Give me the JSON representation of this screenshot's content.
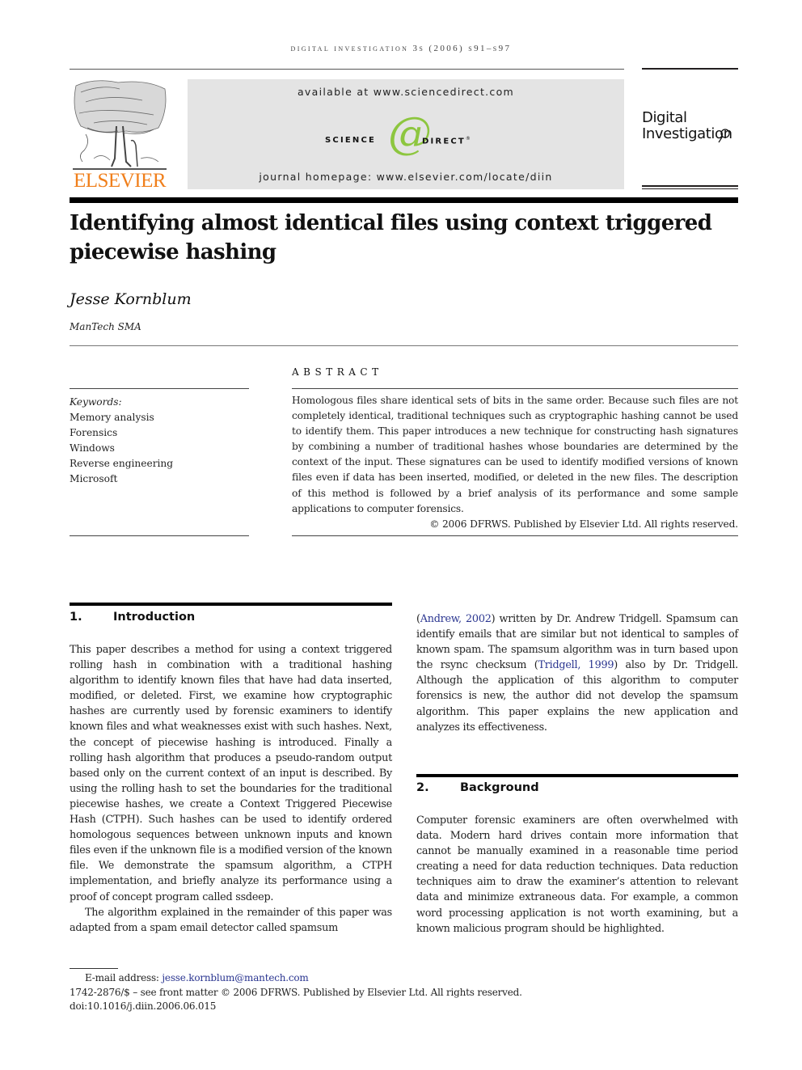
{
  "header": {
    "running_head": "Digital Investigation 3S (2006) S91–S97",
    "publisher_logo_text": "ELSEVIER",
    "publisher_logo_icon": "elsevier-tree-icon",
    "available_at": "available at www.sciencedirect.com",
    "sciencedirect_left": "SCIENCE",
    "sciencedirect_at": "@",
    "sciencedirect_right": "DIRECT",
    "sciencedirect_reg": "®",
    "journal_homepage": "journal homepage: www.elsevier.com/locate/diin",
    "journal_logo_line1": "Digital",
    "journal_logo_line2": "Investigation",
    "journal_logo_icon": "magnifying-glass-icon",
    "colors": {
      "elsevier_orange": "#f07f1b",
      "sciencedirect_green": "#8dc63f",
      "banner_gray": "#e4e4e4",
      "link_blue": "#2a3590"
    }
  },
  "article": {
    "title": "Identifying almost identical files using context triggered piecewise hashing",
    "author": "Jesse Kornblum",
    "affiliation": "ManTech SMA"
  },
  "keywords": {
    "label": "Keywords:",
    "items": [
      "Memory analysis",
      "Forensics",
      "Windows",
      "Reverse engineering",
      "Microsoft"
    ]
  },
  "abstract": {
    "heading": "ABSTRACT",
    "body": "Homologous files share identical sets of bits in the same order. Because such files are not completely identical, traditional techniques such as cryptographic hashing cannot be used to identify them. This paper introduces a new technique for constructing hash signatures by combining a number of traditional hashes whose boundaries are determined by the context of the input. These signatures can be used to identify modified versions of known files even if data has been inserted, modified, or deleted in the new files. The description of this method is followed by a brief analysis of its performance and some sample applications to computer forensics.",
    "copyright": "© 2006 DFRWS. Published by Elsevier Ltd. All rights reserved."
  },
  "sections": [
    {
      "number": "1.",
      "title": "Introduction",
      "paragraphs": [
        "This paper describes a method for using a context triggered rolling hash in combination with a traditional hashing algorithm to identify known files that have had data inserted, modified, or deleted. First, we examine how cryptographic hashes are currently used by forensic examiners to identify known files and what weaknesses exist with such hashes. Next, the concept of piecewise hashing is introduced. Finally a rolling hash algorithm that produces a pseudo-random output based only on the current context of an input is described. By using the rolling hash to set the boundaries for the traditional piecewise hashes, we create a Context Triggered Piecewise Hash (CTPH). Such hashes can be used to identify ordered homologous sequences between unknown inputs and known files even if the unknown file is a modified version of the known file. We demonstrate the spamsum algorithm, a CTPH implementation, and briefly analyze its performance using a proof of concept program called ssdeep.",
        "The algorithm explained in the remainder of this paper was adapted from a spam email detector called spamsum"
      ],
      "continuation": {
        "open_paren": "(",
        "cite1": "Andrew, 2002",
        "text1": ") written by Dr. Andrew Tridgell. Spamsum can identify emails that are similar but not identical to samples of known spam. The spamsum algorithm was in turn based upon the rsync checksum (",
        "cite2": "Tridgell, 1999",
        "text2": ") also by Dr. Tridgell. Although the application of this algorithm to computer forensics is new, the author did not develop the spamsum algorithm. This paper explains the new application and analyzes its effectiveness."
      }
    },
    {
      "number": "2.",
      "title": "Background",
      "paragraphs": [
        "Computer forensic examiners are often overwhelmed with data. Modern hard drives contain more information that cannot be manually examined in a reasonable time period creating a need for data reduction techniques. Data reduction techniques aim to draw the examiner’s attention to relevant data and minimize extraneous data. For example, a common word processing application is not worth examining, but a known malicious program should be highlighted."
      ]
    }
  ],
  "footnote": {
    "email_label": "E-mail address: ",
    "email": "jesse.kornblum@mantech.com",
    "front_matter": "1742-2876/$ – see front matter © 2006 DFRWS. Published by Elsevier Ltd. All rights reserved.",
    "doi": "doi:10.1016/j.diin.2006.06.015"
  }
}
